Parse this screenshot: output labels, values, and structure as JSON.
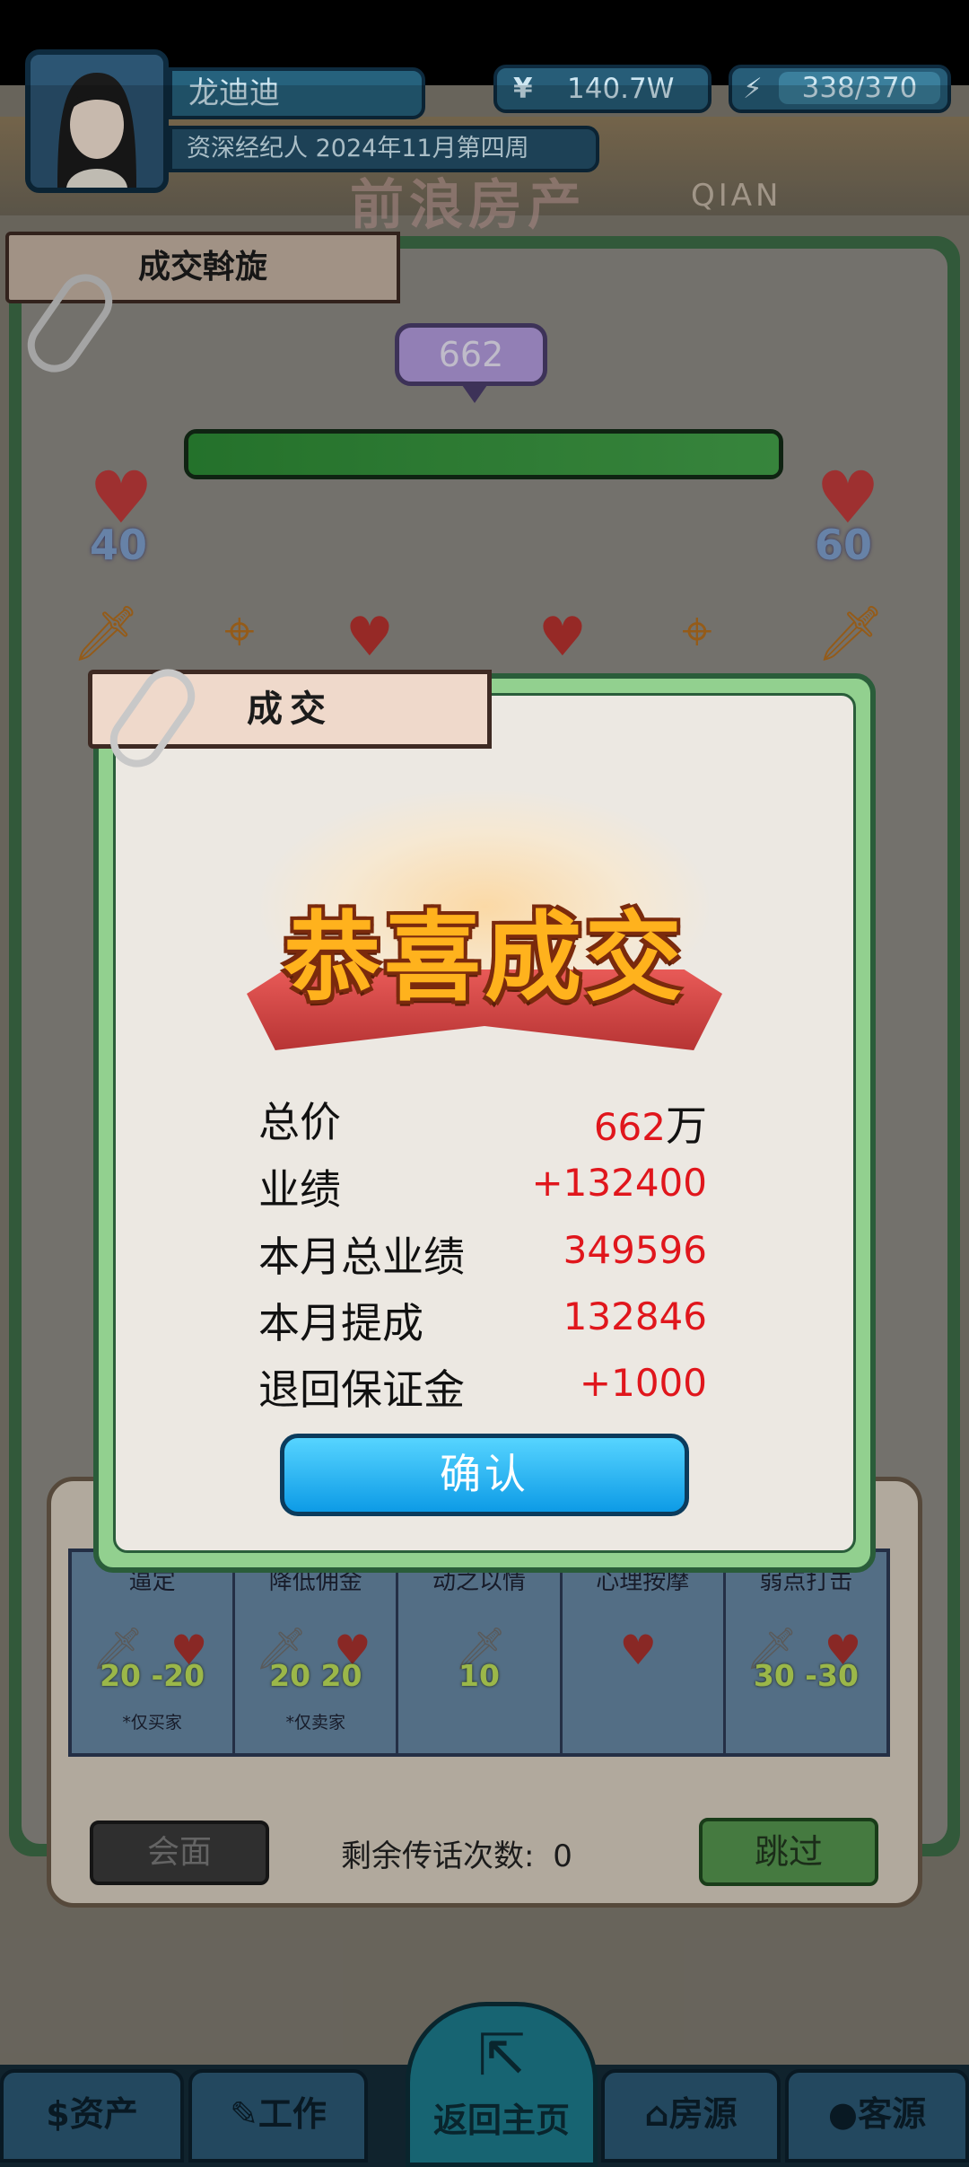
{
  "header": {
    "player_name": "龙迪迪",
    "title_date": "资深经纪人 2024年11月第四周",
    "currency_symbol": "¥",
    "money": "140.7W",
    "energy": "338/370",
    "building_sign": "前浪房产",
    "building_sign_latin": "QIAN"
  },
  "negotiation": {
    "tab_label": "成交斡旋",
    "current_price": "662",
    "left_heart_value": "40",
    "right_heart_value": "60",
    "progress_fraction": 0.5
  },
  "tactics": [
    {
      "name": "逼定",
      "values": "20  -20",
      "note": "*仅买家"
    },
    {
      "name": "降低佣金",
      "values": "20  20",
      "note": "*仅卖家"
    },
    {
      "name": "动之以情",
      "values": "10",
      "note": ""
    },
    {
      "name": "心理按摩",
      "values": "",
      "note": ""
    },
    {
      "name": "弱点打击",
      "values": "30  -30",
      "note": ""
    }
  ],
  "bottom_controls": {
    "meet_label": "会面",
    "remaining_label": "剩余传话次数:",
    "remaining_count": "0",
    "skip_label": "跳过"
  },
  "modal": {
    "tab_label": "成交",
    "headline": "恭喜成交",
    "rows": [
      {
        "label": "总价",
        "value": "662",
        "unit": "万"
      },
      {
        "label": "业绩",
        "value": "+132400",
        "unit": ""
      },
      {
        "label": "本月总业绩",
        "value": "349596",
        "unit": ""
      },
      {
        "label": "本月提成",
        "value": "132846",
        "unit": ""
      },
      {
        "label": "退回保证金",
        "value": "+1000",
        "unit": ""
      }
    ],
    "confirm_label": "确认"
  },
  "nav": {
    "assets": "资产",
    "work": "工作",
    "home": "返回主页",
    "houses": "房源",
    "clients": "客源"
  },
  "colors": {
    "panel_green": "#3d6d47",
    "modal_green": "#92d08f",
    "highlight_red": "#e0161c",
    "confirm_blue": "#0d9be6",
    "headline_gold": "#ffb21d"
  }
}
